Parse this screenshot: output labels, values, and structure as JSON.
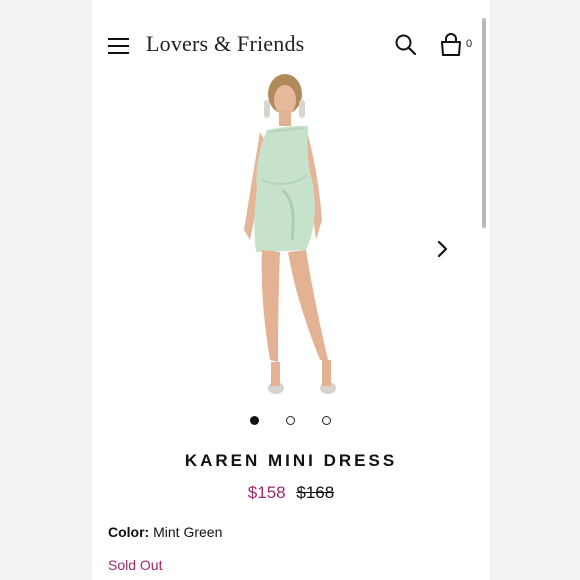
{
  "header": {
    "brand": "Lovers & Friends",
    "bag_count": "0"
  },
  "product": {
    "name": "KAREN MINI DRESS",
    "sale_price": "$158",
    "original_price": "$168",
    "color_label": "Color:",
    "color_value": "Mint Green",
    "availability": "Sold Out",
    "image_alt": "model wearing one-shoulder mint satin wrap mini dress",
    "carousel": {
      "total_slides": 3,
      "active_slide": 1
    }
  },
  "colors": {
    "accent": "#9b2b6c",
    "dress": "#c7e2cb",
    "text": "#111111"
  }
}
